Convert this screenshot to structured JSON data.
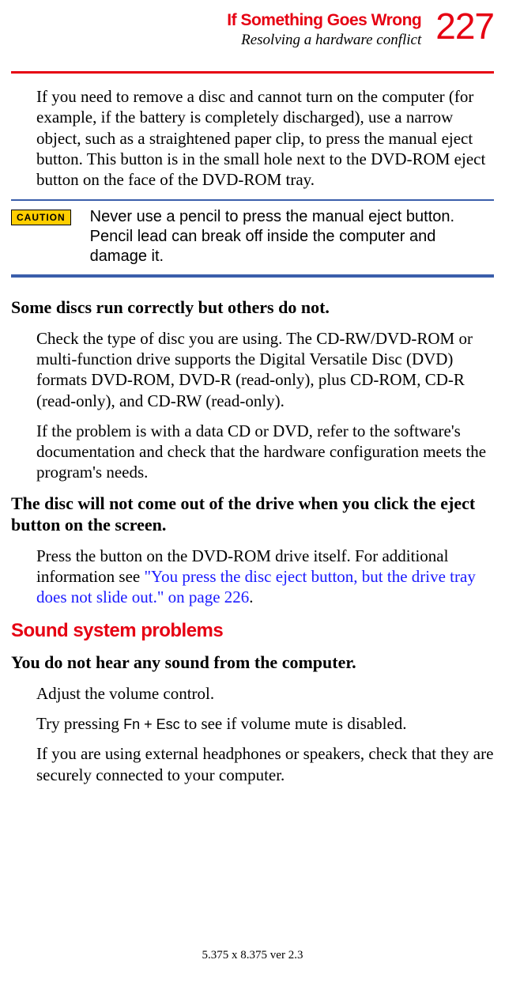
{
  "header": {
    "title": "If Something Goes Wrong",
    "subtitle": "Resolving a hardware conflict",
    "page_number": "227"
  },
  "para1": "If you need to remove a disc and cannot turn on the computer (for example, if the battery is completely discharged), use a narrow object, such as a straightened paper clip, to press the manual eject button. This button is in the small hole next to the DVD-ROM eject button on the face of the DVD-ROM tray.",
  "caution": {
    "label": "CAUTION",
    "text": "Never use a pencil to press the manual eject button. Pencil lead can break off inside the computer and damage it."
  },
  "heading1": "Some discs run correctly but others do not.",
  "para2": "Check the type of disc you are using. The CD-RW/DVD-ROM or multi-function drive supports the Digital Versatile Disc (DVD) formats DVD-ROM, DVD-R (read-only), plus CD-ROM, CD-R (read-only), and CD-RW (read-only).",
  "para3": "If the problem is with a data CD or DVD, refer to the software's documentation and check that the hardware configuration meets the program's needs.",
  "heading2": "The disc will not come out of the drive when you click the eject button on the screen.",
  "para4_pre": "Press the button on the DVD-ROM drive itself. For additional information see ",
  "para4_link": "\"You press the disc eject button, but the drive tray does not slide out.\" on page 226",
  "para4_post": ".",
  "section_title": "Sound system problems",
  "heading3": "You do not hear any sound from the computer.",
  "para5": "Adjust the volume control.",
  "para6_pre": "Try pressing ",
  "para6_key": "Fn + Esc",
  "para6_post": " to see if volume mute is disabled.",
  "para7": "If you are using external headphones or speakers, check that they are securely connected to your computer.",
  "footer": "5.375 x 8.375 ver 2.3"
}
